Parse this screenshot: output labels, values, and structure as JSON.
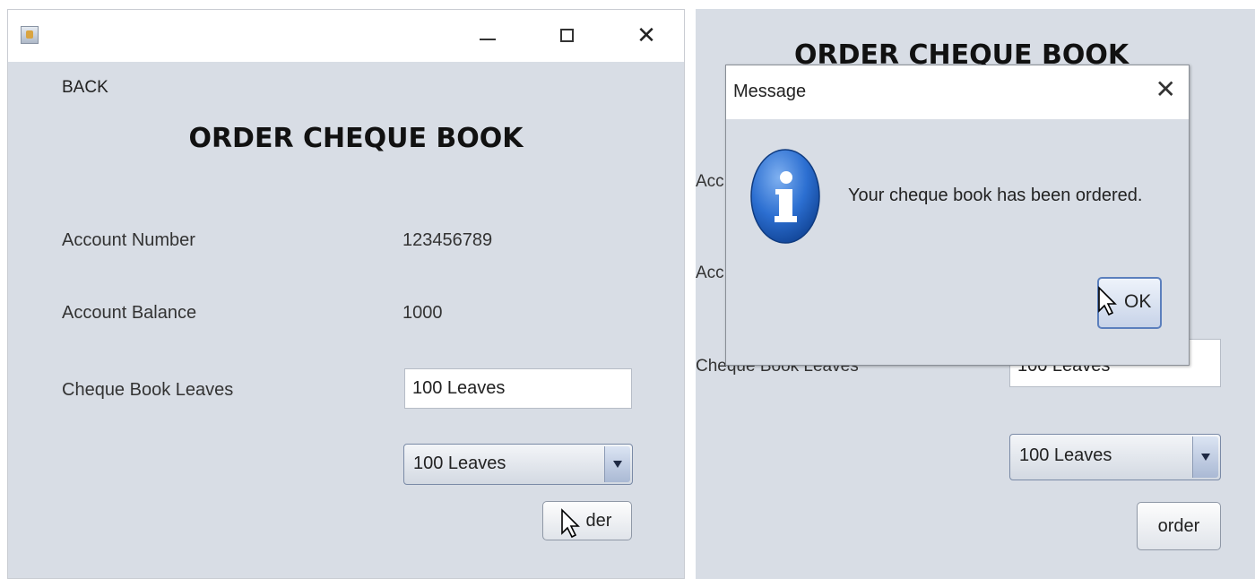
{
  "left": {
    "back_label": "BACK",
    "title": "ORDER CHEQUE BOOK",
    "account_number_label": "Account Number",
    "account_number_value": "123456789",
    "account_balance_label": "Account Balance",
    "account_balance_value": "1000",
    "cheque_leaves_label": "Cheque Book Leaves",
    "cheque_leaves_field": "100 Leaves",
    "leaves_select": "100 Leaves",
    "order_button_visible": "der"
  },
  "right": {
    "background_title": "ORDER CHEQUE BOOK",
    "partial_label_1": "Acc",
    "partial_label_2": "Acc",
    "partial_label_3": "Cheque Book Leaves",
    "partial_field_value": "100 Leaves",
    "leaves_select": "100 Leaves",
    "order_button": "order",
    "dialog": {
      "title": "Message",
      "message": "Your cheque book has been ordered.",
      "ok_visible": "OK"
    }
  },
  "icons": {
    "window_minimize": "minimize-icon",
    "window_maximize": "maximize-icon",
    "window_close": "close-icon",
    "info": "info-icon",
    "dropdown": "chevron-down-icon"
  }
}
